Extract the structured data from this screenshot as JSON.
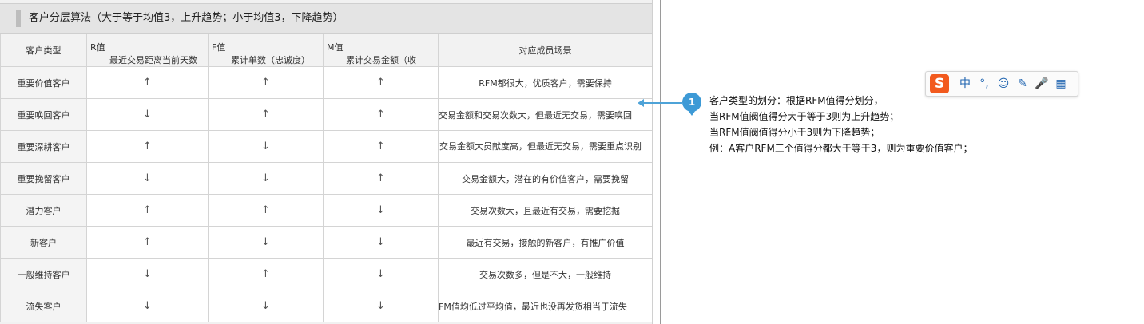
{
  "section": {
    "title": "客户分层算法（大于等于均值3，上升趋势；小于均值3，下降趋势）"
  },
  "table": {
    "headers": {
      "type": "客户类型",
      "r": {
        "name": "R值",
        "desc": "最近交易距离当前天数"
      },
      "f": {
        "name": "F值",
        "desc": "累计单数（忠诚度）"
      },
      "m": {
        "name": "M值",
        "desc": "累计交易金额（收"
      },
      "scene": "对应成员场景"
    },
    "rows": [
      {
        "type": "重要价值客户",
        "r": "↑",
        "f": "↑",
        "m": "↑",
        "scene": "RFM都很大，优质客户，需要保持"
      },
      {
        "type": "重要唤回客户",
        "r": "↓",
        "f": "↑",
        "m": "↑",
        "scene": "交易金额和交易次数大，但最近无交易，需要唤回"
      },
      {
        "type": "重要深耕客户",
        "r": "↑",
        "f": "↓",
        "m": "↑",
        "scene": "交易金额大员献度高，但最近无交易，需要重点识别"
      },
      {
        "type": "重要挽留客户",
        "r": "↓",
        "f": "↓",
        "m": "↑",
        "scene": "交易金额大，潜在的有价值客户，需要挽留"
      },
      {
        "type": "潜力客户",
        "r": "↑",
        "f": "↑",
        "m": "↓",
        "scene": "交易次数大，且最近有交易，需要挖掘"
      },
      {
        "type": "新客户",
        "r": "↑",
        "f": "↓",
        "m": "↓",
        "scene": "最近有交易，接触的新客户，有推广价值"
      },
      {
        "type": "一般维持客户",
        "r": "↓",
        "f": "↑",
        "m": "↓",
        "scene": "交易次数多，但是不大，一般维持"
      },
      {
        "type": "流失客户",
        "r": "↓",
        "f": "↓",
        "m": "↓",
        "scene": "FM值均低过平均值，最近也没再发货相当于流失"
      }
    ]
  },
  "annotation": {
    "badge": "1",
    "lines": [
      "客户类型的划分：根据RFM值得分划分，",
      "当RFM值阀值得分大于等于3则为上升趋势；",
      "当RFM值阀值得分小于3则为下降趋势；",
      "例：A客户RFM三个值得分都大于等于3，则为重要价值客户；"
    ],
    "color": "#3d9ad6"
  },
  "ime_toolbar": {
    "logo": "S",
    "items": [
      {
        "icon": "chinese-mode-icon",
        "glyph": "中"
      },
      {
        "icon": "punctuation-icon",
        "glyph": "°,"
      },
      {
        "icon": "emoji-icon",
        "glyph": "☺"
      },
      {
        "icon": "handwriting-icon",
        "glyph": "✎"
      },
      {
        "icon": "microphone-icon",
        "glyph": "🎤"
      },
      {
        "icon": "toolbox-icon",
        "glyph": "▦"
      }
    ],
    "logo_color": "#f25a1e"
  }
}
